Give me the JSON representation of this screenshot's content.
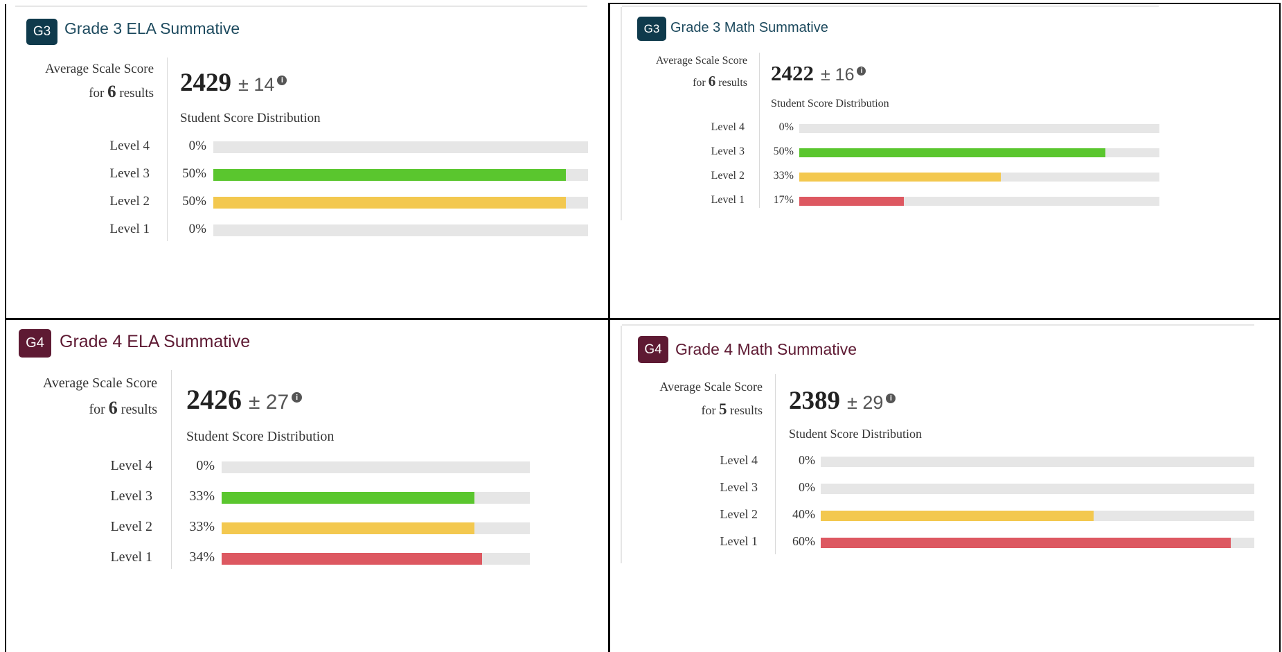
{
  "colors": {
    "level_4": "#e6e6e6",
    "level_3": "#5ac62e",
    "level_2": "#f3c84f",
    "level_1": "#dd5861",
    "track": "#e6e6e6",
    "grade3_badge": "#0f3a4c",
    "grade3_title": "#1d4a5e",
    "grade4_badge": "#5e1a33",
    "grade4_title": "#5e1a33"
  },
  "cards": [
    {
      "badge": "G3",
      "title": "Grade 3 ELA Summative",
      "avg_label_line1": "Average Scale Score",
      "avg_for": "for",
      "result_count": "6",
      "results_word": "results",
      "score": "2429",
      "error": "± 14",
      "info_icon": "info-circle-icon",
      "distribution_label": "Student Score Distribution",
      "levels": [
        {
          "name": "Level 4",
          "percent_label": "0%",
          "fraction": 0.0
        },
        {
          "name": "Level 3",
          "percent_label": "50%",
          "fraction": 0.94
        },
        {
          "name": "Level 2",
          "percent_label": "50%",
          "fraction": 0.94
        },
        {
          "name": "Level 1",
          "percent_label": "0%",
          "fraction": 0.0
        }
      ]
    },
    {
      "badge": "G3",
      "title": "Grade 3 Math Summative",
      "avg_label_line1": "Average Scale Score",
      "avg_for": "for",
      "result_count": "6",
      "results_word": "results",
      "score": "2422",
      "error": "± 16",
      "info_icon": "info-circle-icon",
      "distribution_label": "Student Score Distribution",
      "levels": [
        {
          "name": "Level 4",
          "percent_label": "0%",
          "fraction": 0.0
        },
        {
          "name": "Level 3",
          "percent_label": "50%",
          "fraction": 0.85
        },
        {
          "name": "Level 2",
          "percent_label": "33%",
          "fraction": 0.56
        },
        {
          "name": "Level 1",
          "percent_label": "17%",
          "fraction": 0.29
        }
      ]
    },
    {
      "badge": "G4",
      "title": "Grade 4 ELA Summative",
      "avg_label_line1": "Average Scale Score",
      "avg_for": "for",
      "result_count": "6",
      "results_word": "results",
      "score": "2426",
      "error": "± 27",
      "info_icon": "info-circle-icon",
      "distribution_label": "Student Score Distribution",
      "levels": [
        {
          "name": "Level 4",
          "percent_label": "0%",
          "fraction": 0.0
        },
        {
          "name": "Level 3",
          "percent_label": "33%",
          "fraction": 0.82
        },
        {
          "name": "Level 2",
          "percent_label": "33%",
          "fraction": 0.82
        },
        {
          "name": "Level 1",
          "percent_label": "34%",
          "fraction": 0.845
        }
      ]
    },
    {
      "badge": "G4",
      "title": "Grade 4 Math Summative",
      "avg_label_line1": "Average Scale Score",
      "avg_for": "for",
      "result_count": "5",
      "results_word": "results",
      "score": "2389",
      "error": "± 29",
      "info_icon": "info-circle-icon",
      "distribution_label": "Student Score Distribution",
      "levels": [
        {
          "name": "Level 4",
          "percent_label": "0%",
          "fraction": 0.0
        },
        {
          "name": "Level 3",
          "percent_label": "0%",
          "fraction": 0.0
        },
        {
          "name": "Level 2",
          "percent_label": "40%",
          "fraction": 0.63
        },
        {
          "name": "Level 1",
          "percent_label": "60%",
          "fraction": 0.945
        }
      ]
    }
  ]
}
